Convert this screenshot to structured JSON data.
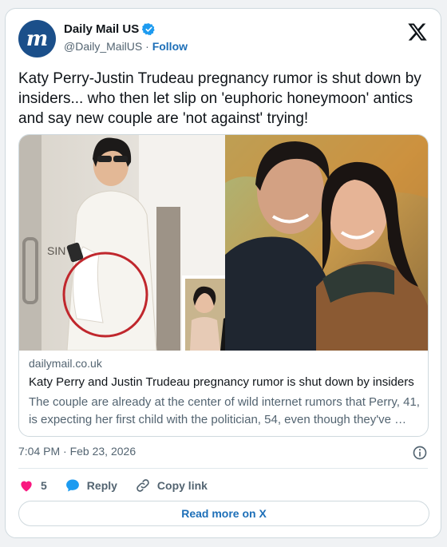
{
  "account": {
    "display_name": "Daily Mail US",
    "handle": "@Daily_MailUS",
    "separator": "·",
    "follow_label": "Follow",
    "avatar_letter": "m",
    "verified": true
  },
  "tweet": {
    "text": "Katy Perry-Justin Trudeau pregnancy rumor is shut down by insiders... who then let slip on 'euphoric honeymoon' antics and say new couple are 'not against' trying!"
  },
  "link_card": {
    "domain": "dailymail.co.uk",
    "title": "Katy Perry and Justin Trudeau pregnancy rumor is shut down by insiders",
    "description": "The couple are already at the center of wild internet rumors that Perry, 41, is expecting her first child with the politician, 54, even though they've …",
    "image_text": "SIN"
  },
  "meta": {
    "time": "7:04 PM",
    "separator": "·",
    "date": "Feb 23, 2026"
  },
  "actions": {
    "likes_count": "5",
    "reply_label": "Reply",
    "copy_link_label": "Copy link"
  },
  "read_more_label": "Read more on X",
  "colors": {
    "accent": "#1d6fb8",
    "like": "#f91880",
    "reply": "#1d9bf0",
    "avatar": "#1b4f8a",
    "highlight_circle": "#c0272d"
  }
}
